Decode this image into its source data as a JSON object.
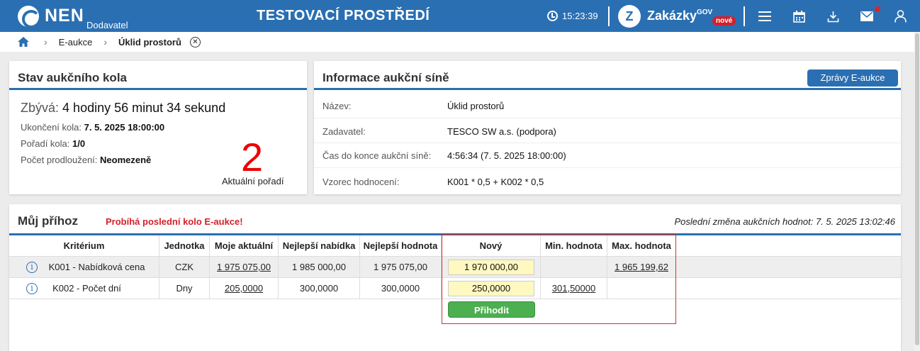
{
  "header": {
    "logo_text": "NEN",
    "logo_sub": "Dodavatel",
    "env_title": "TESTOVACÍ PROSTŘEDÍ",
    "time": "15:23:39",
    "zakazky": "Zakázky",
    "gov": "GOV",
    "new_badge": "nové",
    "accent": "#2a6fb2"
  },
  "breadcrumb": {
    "items": [
      "E-aukce",
      "Úklid prostorů"
    ]
  },
  "stav": {
    "title": "Stav aukčního kola",
    "remain_label": "Zbývá:",
    "remain_value": "4 hodiny 56 minut 34 sekund",
    "end_label": "Ukončení kola:",
    "end_value": "7. 5. 2025 18:00:00",
    "order_label": "Pořadí kola:",
    "order_value": "1/0",
    "ext_label": "Počet prodloužení:",
    "ext_value": "Neomezeně",
    "rank": "2",
    "rank_label": "Aktuální pořadí"
  },
  "info": {
    "title": "Informace aukční síně",
    "button": "Zprávy E-aukce",
    "rows": [
      {
        "label": "Název:",
        "value": "Úklid prostorů"
      },
      {
        "label": "Zadavatel:",
        "value": "TESCO SW a.s. (podpora)"
      },
      {
        "label": "Čas do konce aukční síně:",
        "value": "4:56:34 (7. 5. 2025 18:00:00)"
      },
      {
        "label": "Vzorec hodnocení:",
        "value": "K001 * 0,5 + K002 * 0,5"
      }
    ]
  },
  "prihoz": {
    "title": "Můj příhoz",
    "warning": "Probíhá poslední kolo E-aukce!",
    "last_change": "Poslední změna aukčních hodnot: 7. 5. 2025 13:02:46",
    "columns": [
      "Kritérium",
      "Jednotka",
      "Moje aktuální",
      "Nejlepší nabídka",
      "Nejlepší hodnota",
      "Nový",
      "Min. hodnota",
      "Max. hodnota"
    ],
    "rows": [
      {
        "criterion": "K001 - Nabídková cena",
        "unit": "CZK",
        "mine": "1 975 075,00",
        "best_offer": "1 985 000,00",
        "best_value": "1 975 075,00",
        "new": "1 970 000,00",
        "min": "",
        "max": "1 965 199,62"
      },
      {
        "criterion": "K002 - Počet dní",
        "unit": "Dny",
        "mine": "205,0000",
        "best_offer": "300,0000",
        "best_value": "300,0000",
        "new": "250,0000",
        "min": "301,50000",
        "max": ""
      }
    ],
    "submit": "Přihodit"
  }
}
